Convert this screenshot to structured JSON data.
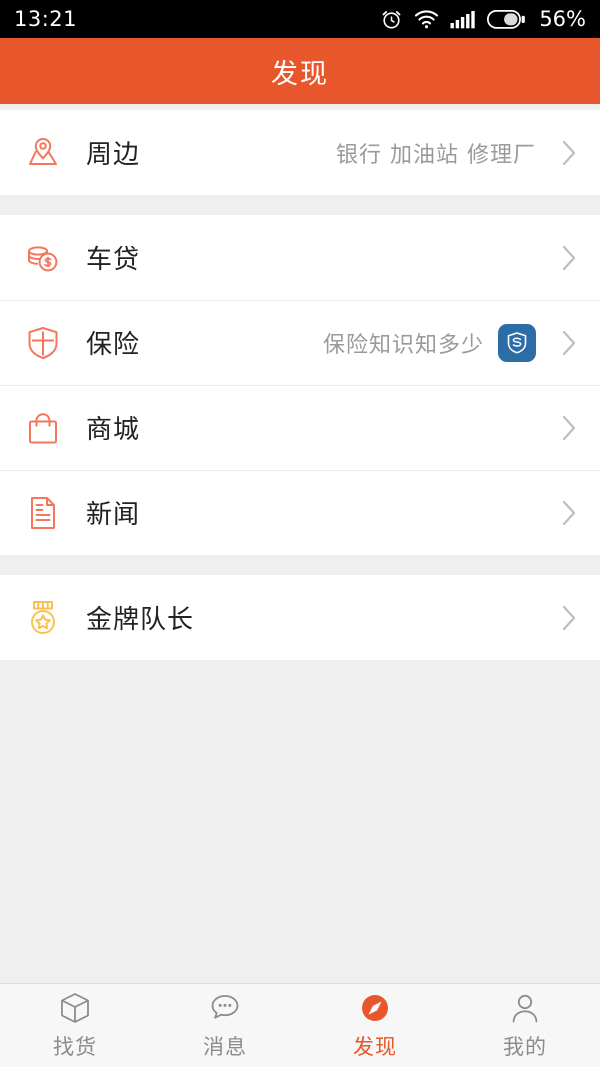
{
  "statusbar": {
    "time": "13:21",
    "battery_text": "56%",
    "battery_level": 56,
    "icons": [
      "alarm-icon",
      "wifi-icon",
      "signal-icon",
      "battery-icon"
    ]
  },
  "header": {
    "title": "发现",
    "background": "#E8562B"
  },
  "colors": {
    "accent": "#E8562B",
    "icon_salmon": "#F4775D",
    "icon_gold": "#F7C24F",
    "badge_blue": "#2C6DA8",
    "chevron_gray": "#BDBDBD",
    "subtext_gray": "#9A9A9A"
  },
  "groups": [
    {
      "rows": [
        {
          "label": "周边",
          "icon": "map-pin-icon",
          "sub": "银行 加油站 修理厂",
          "badge": null,
          "chevron": "chevron-right-icon"
        }
      ]
    },
    {
      "rows": [
        {
          "label": "车贷",
          "icon": "coins-icon",
          "sub": "",
          "badge": null,
          "chevron": "chevron-right-icon"
        },
        {
          "label": "保险",
          "icon": "shield-cross-icon",
          "sub": "保险知识知多少",
          "badge": "shield-s-badge-icon",
          "chevron": "chevron-right-icon"
        },
        {
          "label": "商城",
          "icon": "shopping-bag-icon",
          "sub": "",
          "badge": null,
          "chevron": "chevron-right-icon"
        },
        {
          "label": "新闻",
          "icon": "document-icon",
          "sub": "",
          "badge": null,
          "chevron": "chevron-right-icon"
        }
      ]
    },
    {
      "rows": [
        {
          "label": "金牌队长",
          "icon": "medal-icon",
          "sub": "",
          "badge": null,
          "chevron": "chevron-right-icon"
        }
      ]
    }
  ],
  "tabbar": {
    "items": [
      {
        "label": "找货",
        "icon": "box-icon",
        "active": false
      },
      {
        "label": "消息",
        "icon": "chat-bubble-icon",
        "active": false
      },
      {
        "label": "发现",
        "icon": "compass-icon",
        "active": true
      },
      {
        "label": "我的",
        "icon": "person-icon",
        "active": false
      }
    ]
  }
}
